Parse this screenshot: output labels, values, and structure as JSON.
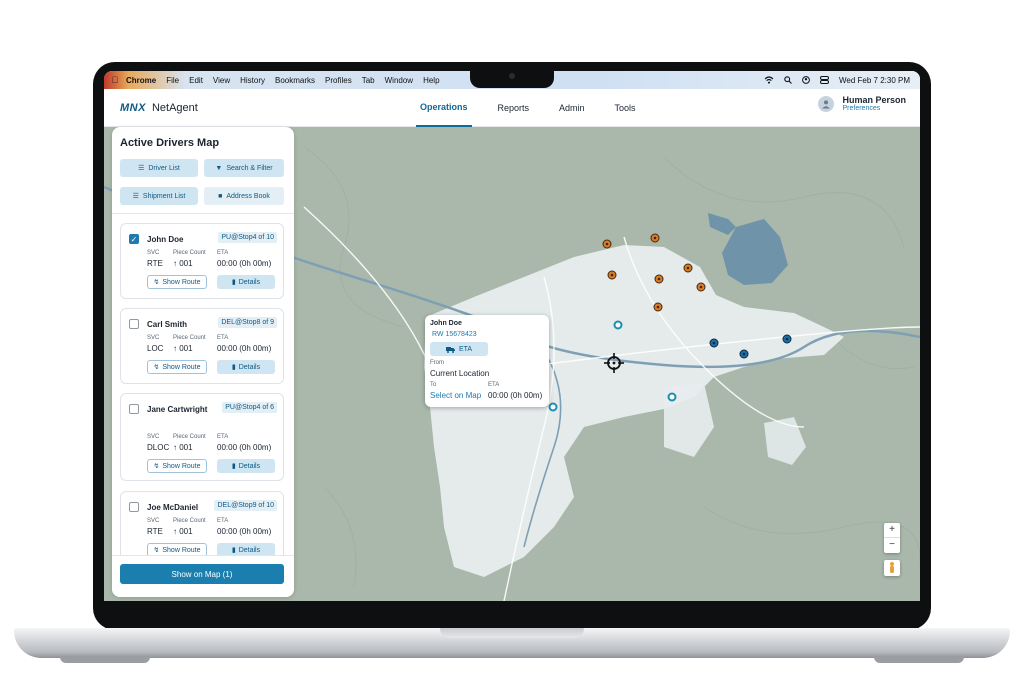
{
  "menubar": {
    "items": [
      "Chrome",
      "File",
      "Edit",
      "View",
      "History",
      "Bookmarks",
      "Profiles",
      "Tab",
      "Window",
      "Help"
    ],
    "clock": "Wed Feb 7  2:30 PM"
  },
  "header": {
    "brand_mark": "MNX",
    "app_name": "NetAgent",
    "tabs": [
      "Operations",
      "Reports",
      "Admin",
      "Tools"
    ],
    "active_tab": "Operations",
    "user_name": "Human Person",
    "preferences_link": "Preferences"
  },
  "sidebar": {
    "title": "Active Drivers Map",
    "buttons": {
      "driver_list": "Driver List",
      "search_filter": "Search & Filter",
      "shipment_list": "Shipment List",
      "address_book": "Address Book"
    },
    "labels": {
      "svc": "SVC",
      "piece_count": "Piece Count",
      "eta": "ETA",
      "show_route": "Show Route",
      "details": "Details"
    },
    "drivers": [
      {
        "name": "John Doe",
        "stop": "PU@Stop4 of 10",
        "svc": "RTE",
        "pieces": "↑ 001",
        "eta": "00:00 (0h 00m)",
        "checked": true
      },
      {
        "name": "Carl Smith",
        "stop": "DEL@Stop8 of 9",
        "svc": "LOC",
        "pieces": "↑ 001",
        "eta": "00:00 (0h 00m)",
        "checked": false
      },
      {
        "name": "Jane Cartwright",
        "stop": "PU@Stop4 of 6",
        "svc": "DLOC",
        "pieces": "↑ 001",
        "eta": "00:00 (0h 00m)",
        "checked": false
      },
      {
        "name": "Joe McDaniel",
        "stop": "DEL@Stop9 of 10",
        "svc": "RTE",
        "pieces": "↑ 001",
        "eta": "00:00 (0h 00m)",
        "checked": false
      }
    ],
    "show_on_map": "Show on Map (1)"
  },
  "popup": {
    "driver": "John Doe",
    "route_id": "RW 15678423",
    "eta_button": "ETA",
    "from_label": "From",
    "from_value": "Current Location",
    "to_label": "To",
    "to_value": "Select on Map",
    "eta_label": "ETA",
    "eta_value": "00:00 (0h 00m)"
  },
  "map": {
    "zoom_in": "+",
    "zoom_out": "−",
    "colors": {
      "water": "#6f93a8",
      "urban": "#e8ecee",
      "land": "#a9b8ab",
      "pickup_pin": "#e07b1f",
      "delivery_pin": "#1c6fa8"
    }
  }
}
